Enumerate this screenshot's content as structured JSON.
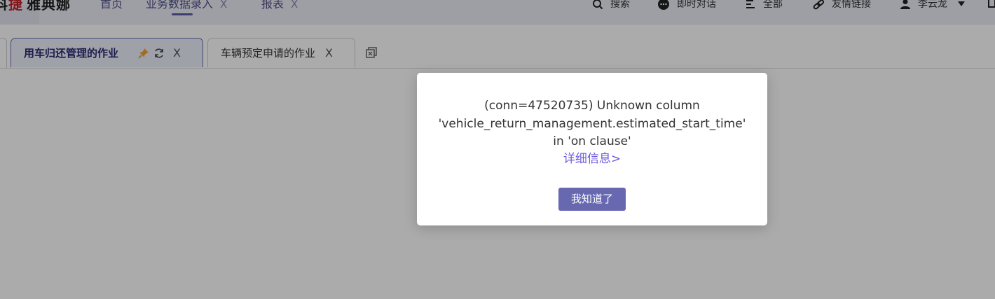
{
  "header": {
    "logo_text_part1": "科",
    "logo_text_red": "捷",
    "logo_text_part2": "雅典娜",
    "nav": [
      {
        "label": "首页",
        "closable": false
      },
      {
        "label": "业务数据录入",
        "closable": true,
        "close": "X"
      },
      {
        "label": "报表",
        "closable": true,
        "close": "X"
      }
    ],
    "right_nav": [
      {
        "label": "搜索",
        "icon": "search-icon"
      },
      {
        "label": "即时对话",
        "icon": "chat-icon"
      },
      {
        "label": "全部",
        "icon": "list-icon"
      },
      {
        "label": "友情链接",
        "icon": "link-icon"
      },
      {
        "label": "李云龙",
        "icon": "user-icon"
      }
    ]
  },
  "tabs": [
    {
      "label": "用车归还管理的作业",
      "active": true,
      "close": "X"
    },
    {
      "label": "车辆预定申请的作业",
      "active": false,
      "close": "X"
    }
  ],
  "dialog": {
    "message_line1": "(conn=47520735) Unknown column",
    "message_line2": "'vehicle_return_management.estimated_start_time'",
    "message_line3": "in 'on clause'",
    "detail_link": "详细信息>",
    "ok_button": "我知道了"
  },
  "colors": {
    "accent": "#6768b0",
    "link": "#6b59e0",
    "pin": "#f0a030",
    "logo_red": "#c2212a"
  }
}
